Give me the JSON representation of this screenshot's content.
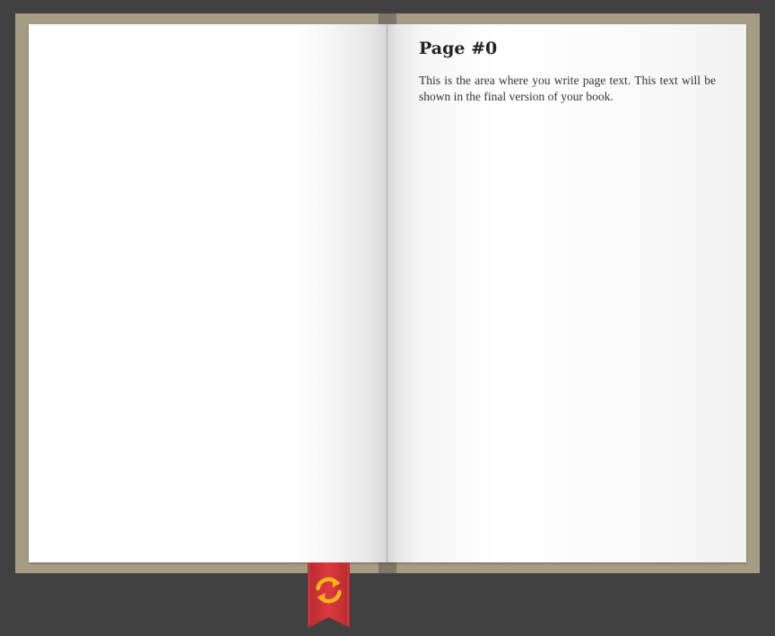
{
  "book": {
    "right_page": {
      "title": "Page #0",
      "text": "This is the area where you write page text. This text will be shown in the final version of your book."
    },
    "colors": {
      "background": "#414141",
      "cover": "#a59c83",
      "spine": "#7e7767",
      "bookmark": "#d8353a",
      "refresh_icon": "#f4b41a"
    }
  },
  "bookmark": {
    "icon": "refresh-icon"
  }
}
